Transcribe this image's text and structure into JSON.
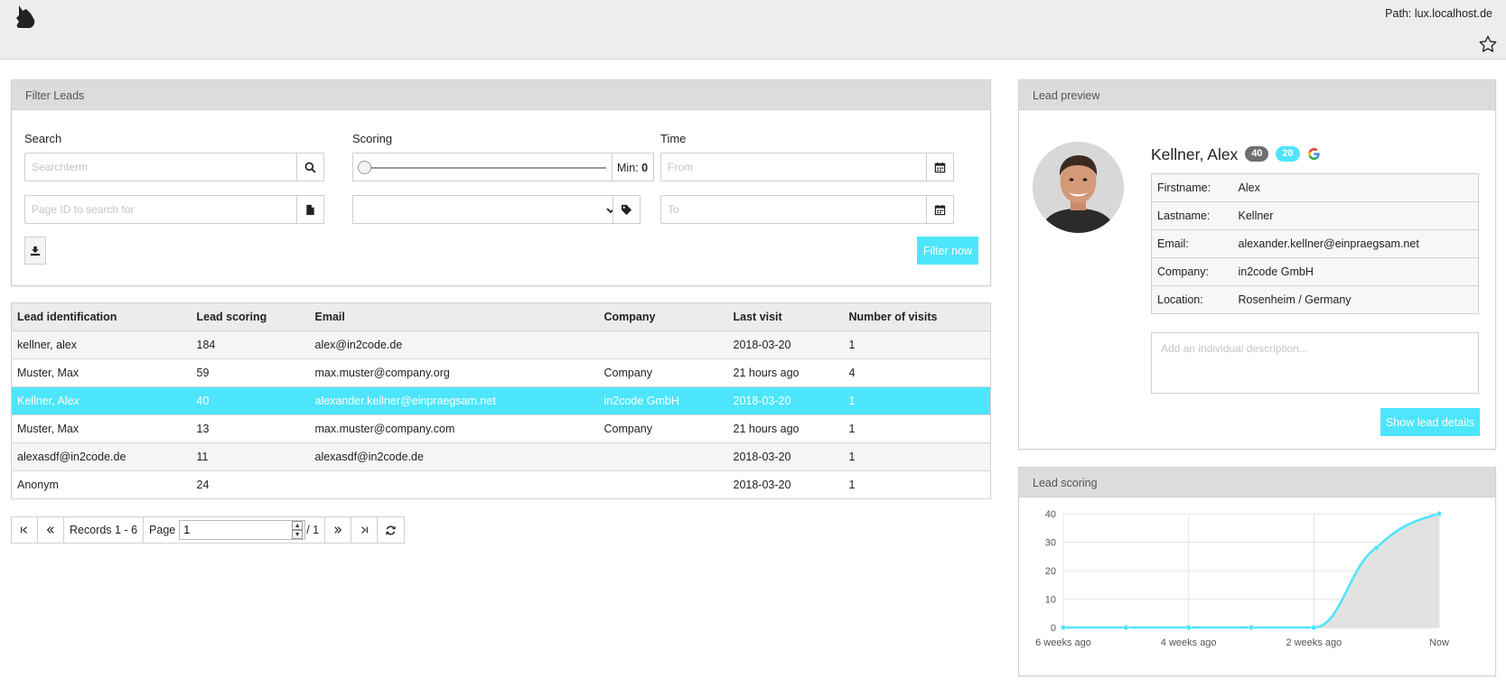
{
  "header": {
    "path": "Path: lux.localhost.de",
    "logo_icon": "lux-cat-logo",
    "star_icon": "star-icon"
  },
  "filter": {
    "title": "Filter Leads",
    "search_label": "Search",
    "search_placeholder": "Searchterm",
    "pageid_placeholder": "Page ID to search for",
    "scoring_label": "Scoring",
    "min_label": "Min:",
    "min_value": "0",
    "min_slider_value": 0,
    "category_selected": "",
    "time_label": "Time",
    "from_placeholder": "From",
    "to_placeholder": "To",
    "filter_button": "Filter now"
  },
  "table": {
    "headers": [
      "Lead identification",
      "Lead scoring",
      "Email",
      "Company",
      "Last visit",
      "Number of visits"
    ],
    "rows": [
      {
        "id": "kellner, alex",
        "scoring": "184",
        "email": "alex@in2code.de",
        "company": "",
        "last_visit": "2018-03-20",
        "visits": "1"
      },
      {
        "id": "Muster, Max",
        "scoring": "59",
        "email": "max.muster@company.org",
        "company": "Company",
        "last_visit": "21 hours ago",
        "visits": "4"
      },
      {
        "id": "Kellner, Alex",
        "scoring": "40",
        "email": "alexander.kellner@einpraegsam.net",
        "company": "in2code GmbH",
        "last_visit": "2018-03-20",
        "visits": "1"
      },
      {
        "id": "Muster, Max",
        "scoring": "13",
        "email": "max.muster@company.com",
        "company": "Company",
        "last_visit": "21 hours ago",
        "visits": "1"
      },
      {
        "id": "alexasdf@in2code.de",
        "scoring": "11",
        "email": "alexasdf@in2code.de",
        "company": "",
        "last_visit": "2018-03-20",
        "visits": "1"
      },
      {
        "id": "Anonym",
        "scoring": "24",
        "email": "",
        "company": "",
        "last_visit": "2018-03-20",
        "visits": "1"
      }
    ]
  },
  "pager": {
    "records": "Records 1 - 6",
    "page_label": "Page",
    "page_value": "1",
    "total": "/ 1"
  },
  "preview": {
    "title": "Lead preview",
    "name": "Kellner, Alex",
    "badge_score": "40",
    "badge_category": "20",
    "fields": [
      {
        "key": "Firstname:",
        "value": "Alex"
      },
      {
        "key": "Lastname:",
        "value": "Kellner"
      },
      {
        "key": "Email:",
        "value": "alexander.kellner@einpraegsam.net"
      },
      {
        "key": "Company:",
        "value": "in2code GmbH"
      },
      {
        "key": "Location:",
        "value": "Rosenheim / Germany"
      }
    ],
    "description_placeholder": "Add an individual description...",
    "details_button": "Show lead details"
  },
  "scoring": {
    "title": "Lead scoring"
  },
  "chart_data": {
    "type": "area",
    "x": [
      "6 weeks ago",
      "5 weeks ago",
      "4 weeks ago",
      "3 weeks ago",
      "2 weeks ago",
      "1 week ago",
      "Now"
    ],
    "xticklabels": [
      "6 weeks ago",
      "4 weeks ago",
      "2 weeks ago",
      "Now"
    ],
    "series": [
      {
        "values": [
          0,
          0,
          0,
          0,
          0,
          28,
          40
        ]
      }
    ],
    "ylim": [
      0,
      40
    ],
    "yticks": [
      0,
      10,
      20,
      30,
      40
    ],
    "grid": true,
    "line_color": "#4de5fb",
    "fill_color": "#e2e2e2"
  },
  "colors": {
    "accent": "#4de5fb",
    "badge_grey": "#6f6f6f"
  }
}
